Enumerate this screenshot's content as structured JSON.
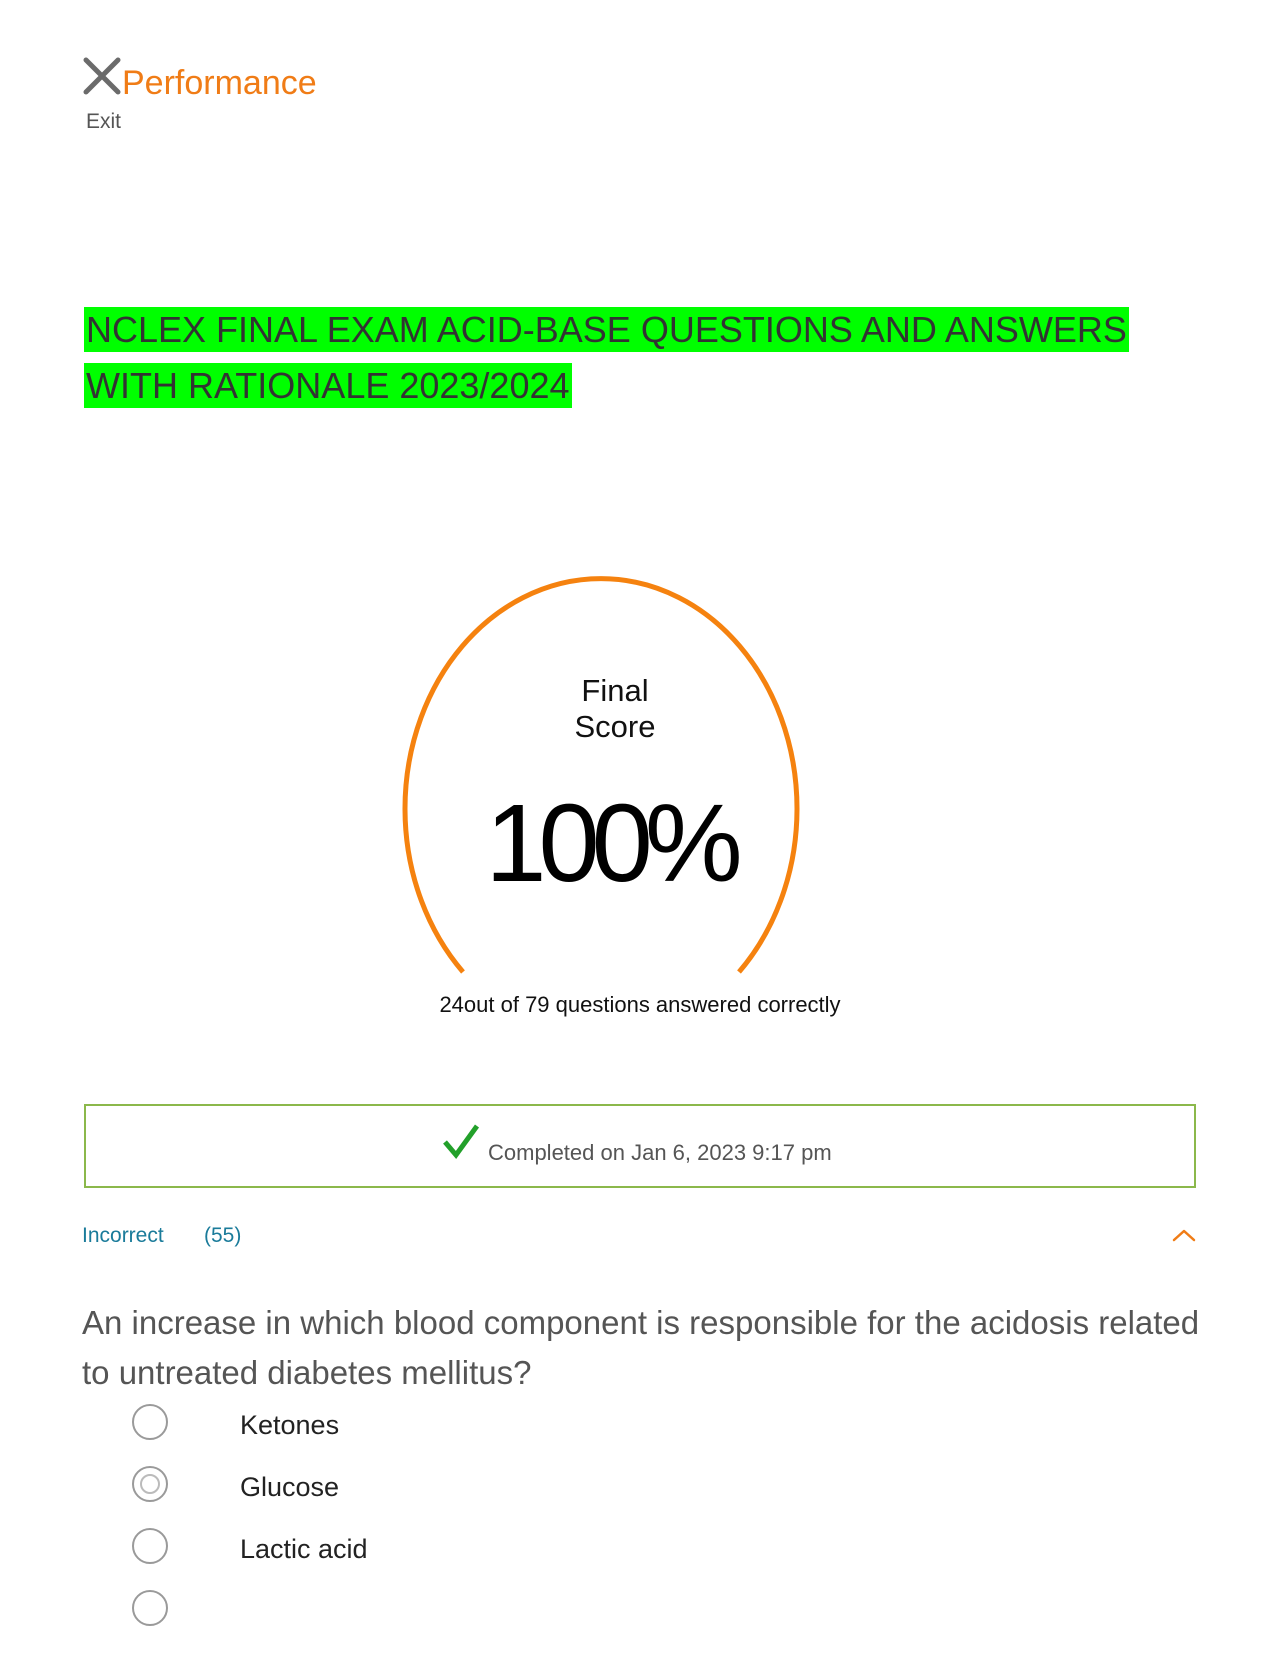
{
  "header": {
    "title": "Performance",
    "exit_label": "Exit"
  },
  "exam": {
    "title": "NCLEX FINAL EXAM ACID-BASE QUESTIONS AND ANSWERS WITH RATIONALE 2023/2024",
    "title_highlight_color": "#00ff00"
  },
  "score": {
    "label": "Final Score",
    "value": "100%",
    "gauge_fraction": 1.0,
    "gauge_color": "#f5820f",
    "summary": "24out of 79 questions answered correctly"
  },
  "completion": {
    "text": "Completed on Jan 6, 2023 9:17 pm",
    "icon": "check-icon",
    "check_color": "#22a02a",
    "border_color": "#8bb84b"
  },
  "results": {
    "tab_label": "Incorrect",
    "count": "(55)",
    "toggle_icon": "chevron-up-icon",
    "accent_color": "#1a7b9a"
  },
  "question": {
    "text": "An increase in which blood component is responsible for the acidosis related to untreated diabetes mellitus?",
    "options": [
      {
        "label": "Ketones",
        "selected": false
      },
      {
        "label": "Glucose",
        "selected": true
      },
      {
        "label": "Lactic acid",
        "selected": false
      },
      {
        "label": "",
        "selected": false
      }
    ]
  }
}
